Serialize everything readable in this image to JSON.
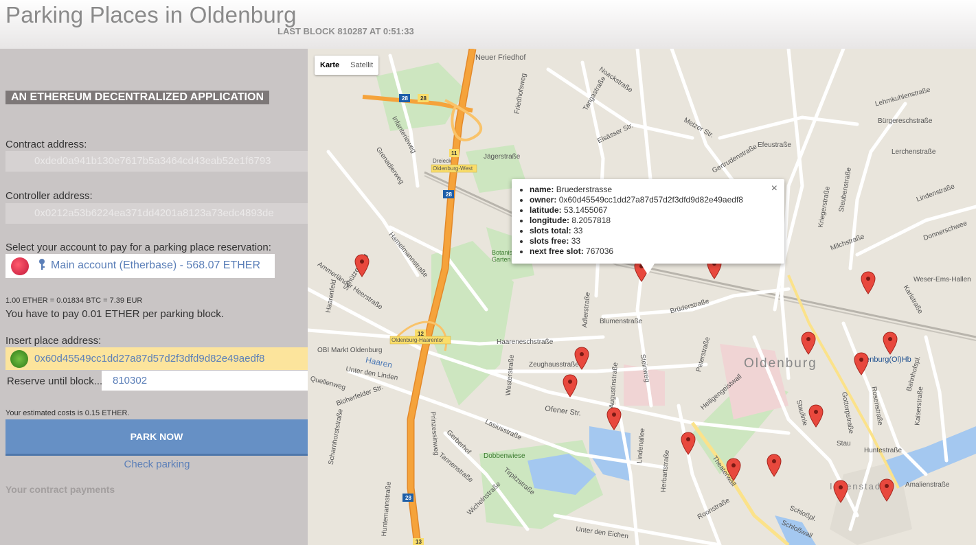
{
  "header": {
    "title": "Parking Places in Oldenburg",
    "last_block": "LAST BLOCK 810287 AT 0:51:33"
  },
  "sidebar": {
    "banner": "AN ETHEREUM DECENTRALIZED APPLICATION",
    "contract_label": "Contract address:",
    "contract_value": "0xded0a941b130e7617b5a3464cd43eab52e1f6793",
    "controller_label": "Controller address:",
    "controller_value": "0x0212a53b6224ea371dd4201a8123a73edc4893de",
    "account_label": "Select your account to pay for a parking place reservation:",
    "account_value": "Main account (Etherbase) - 568.07 ETHER",
    "rate": "1.00 ETHER = 0.01834 BTC = 7.39 EUR",
    "pay_text": "You have to pay 0.01 ETHER per parking block.",
    "place_label": "Insert place address:",
    "place_value": "0x60d45549cc1dd27a87d57d2f3dfd9d82e49aedf8",
    "reserve_label": "Reserve until block....",
    "reserve_value": "810302",
    "estimate": "Your estimated costs is 0.15 ETHER.",
    "park_button": "PARK NOW",
    "check_link": "Check parking",
    "payments_heading": "Your contract payments"
  },
  "map": {
    "map_type_options": [
      "Karte",
      "Satellit"
    ],
    "selected_map_type": "Karte",
    "streets": [
      {
        "label": "Neuer Friedhof"
      },
      {
        "label": "Jägerstraße"
      },
      {
        "label": "Grenadierweg"
      },
      {
        "label": "Infanterieweg"
      },
      {
        "label": "Friedhofsweg"
      },
      {
        "label": "Noackstraße"
      },
      {
        "label": "Tangastraße"
      },
      {
        "label": "Metzer Str."
      },
      {
        "label": "Elsässer Str."
      },
      {
        "label": "Gertrudenstraße"
      },
      {
        "label": "Efeustraße"
      },
      {
        "label": "Lehmkuhlenstraße"
      },
      {
        "label": "Bürgereschstraße"
      },
      {
        "label": "Lerchenstraße"
      },
      {
        "label": "Lindenstraße"
      },
      {
        "label": "Steubenstraße"
      },
      {
        "label": "Kriegerstraße"
      },
      {
        "label": "Milchstraße"
      },
      {
        "label": "Donnerschwee"
      },
      {
        "label": "Weser-Ems-Hallen"
      },
      {
        "label": "Karlstraße"
      },
      {
        "label": "Hamelmannstraße"
      },
      {
        "label": "Ammerländer Heerstraße"
      },
      {
        "label": "Schützenweg"
      },
      {
        "label": "Haarenfeld"
      },
      {
        "label": "Adlerstraße"
      },
      {
        "label": "Blumenstraße"
      },
      {
        "label": "Brüderstraße"
      },
      {
        "label": "Haareneschstraße"
      },
      {
        "label": "OBI Markt Oldenburg"
      },
      {
        "label": "Haaren"
      },
      {
        "label": "Unter den Linden"
      },
      {
        "label": "Quellenweg"
      },
      {
        "label": "Bloherfelder Str."
      },
      {
        "label": "Westerstraße"
      },
      {
        "label": "Zeughausstraße"
      },
      {
        "label": "Augustinstraße"
      },
      {
        "label": "Steinweg"
      },
      {
        "label": "Peterstraße"
      },
      {
        "label": "Heiligengeistwall"
      },
      {
        "label": "Oldenburg"
      },
      {
        "label": "Oldenburg(Ol)Hb"
      },
      {
        "label": "Staulinie"
      },
      {
        "label": "Gottorpstraße"
      },
      {
        "label": "Rosenstraße"
      },
      {
        "label": "Bahnhofspl."
      },
      {
        "label": "Kaiserstraße"
      },
      {
        "label": "Ofener Str."
      },
      {
        "label": "Lasiusstraße"
      },
      {
        "label": "Gerberhof"
      },
      {
        "label": "Dobbenwiese"
      },
      {
        "label": "Prinzessinweg"
      },
      {
        "label": "Tannenstraße"
      },
      {
        "label": "Wichelnstraße"
      },
      {
        "label": "Tirpitzstraße"
      },
      {
        "label": "Lindenallee"
      },
      {
        "label": "Herbartstraße"
      },
      {
        "label": "Theaterwall"
      },
      {
        "label": "Roonstraße"
      },
      {
        "label": "Stau"
      },
      {
        "label": "Huntestraße"
      },
      {
        "label": "Innenstadt"
      },
      {
        "label": "Amalienstraße"
      },
      {
        "label": "Schloßpl."
      },
      {
        "label": "Schloßwall"
      },
      {
        "label": "Unter den Eichen"
      },
      {
        "label": "Huntemannstraße"
      },
      {
        "label": "Scharnhorststraße"
      },
      {
        "label": "Dreieck Oldenburg-West"
      },
      {
        "label": "Oldenburg-Haarentor"
      },
      {
        "label": "Botanischer Garten"
      }
    ],
    "route_shields": [
      "28",
      "28",
      "28",
      "11",
      "12",
      "28",
      "13"
    ],
    "infowindow": {
      "items": [
        {
          "key": "name:",
          "value": "Bruederstrasse"
        },
        {
          "key": "owner:",
          "value": "0x60d45549cc1dd27a87d57d2f3dfd9d82e49aedf8"
        },
        {
          "key": "latitude:",
          "value": "53.1455067"
        },
        {
          "key": "longitude:",
          "value": "8.2057818"
        },
        {
          "key": "slots total:",
          "value": "33"
        },
        {
          "key": "slots free:",
          "value": "33"
        },
        {
          "key": "next free slot:",
          "value": "767036"
        }
      ],
      "close": "×"
    },
    "marker_count": 19
  },
  "colors": {
    "sidebar_bg": "#c9c5c5",
    "accent_blue": "#6690c5",
    "link_blue": "#5b7fb8",
    "place_field_bg": "#fce49c",
    "marker_red": "#e8483d",
    "highway_orange": "#f5a33b"
  }
}
